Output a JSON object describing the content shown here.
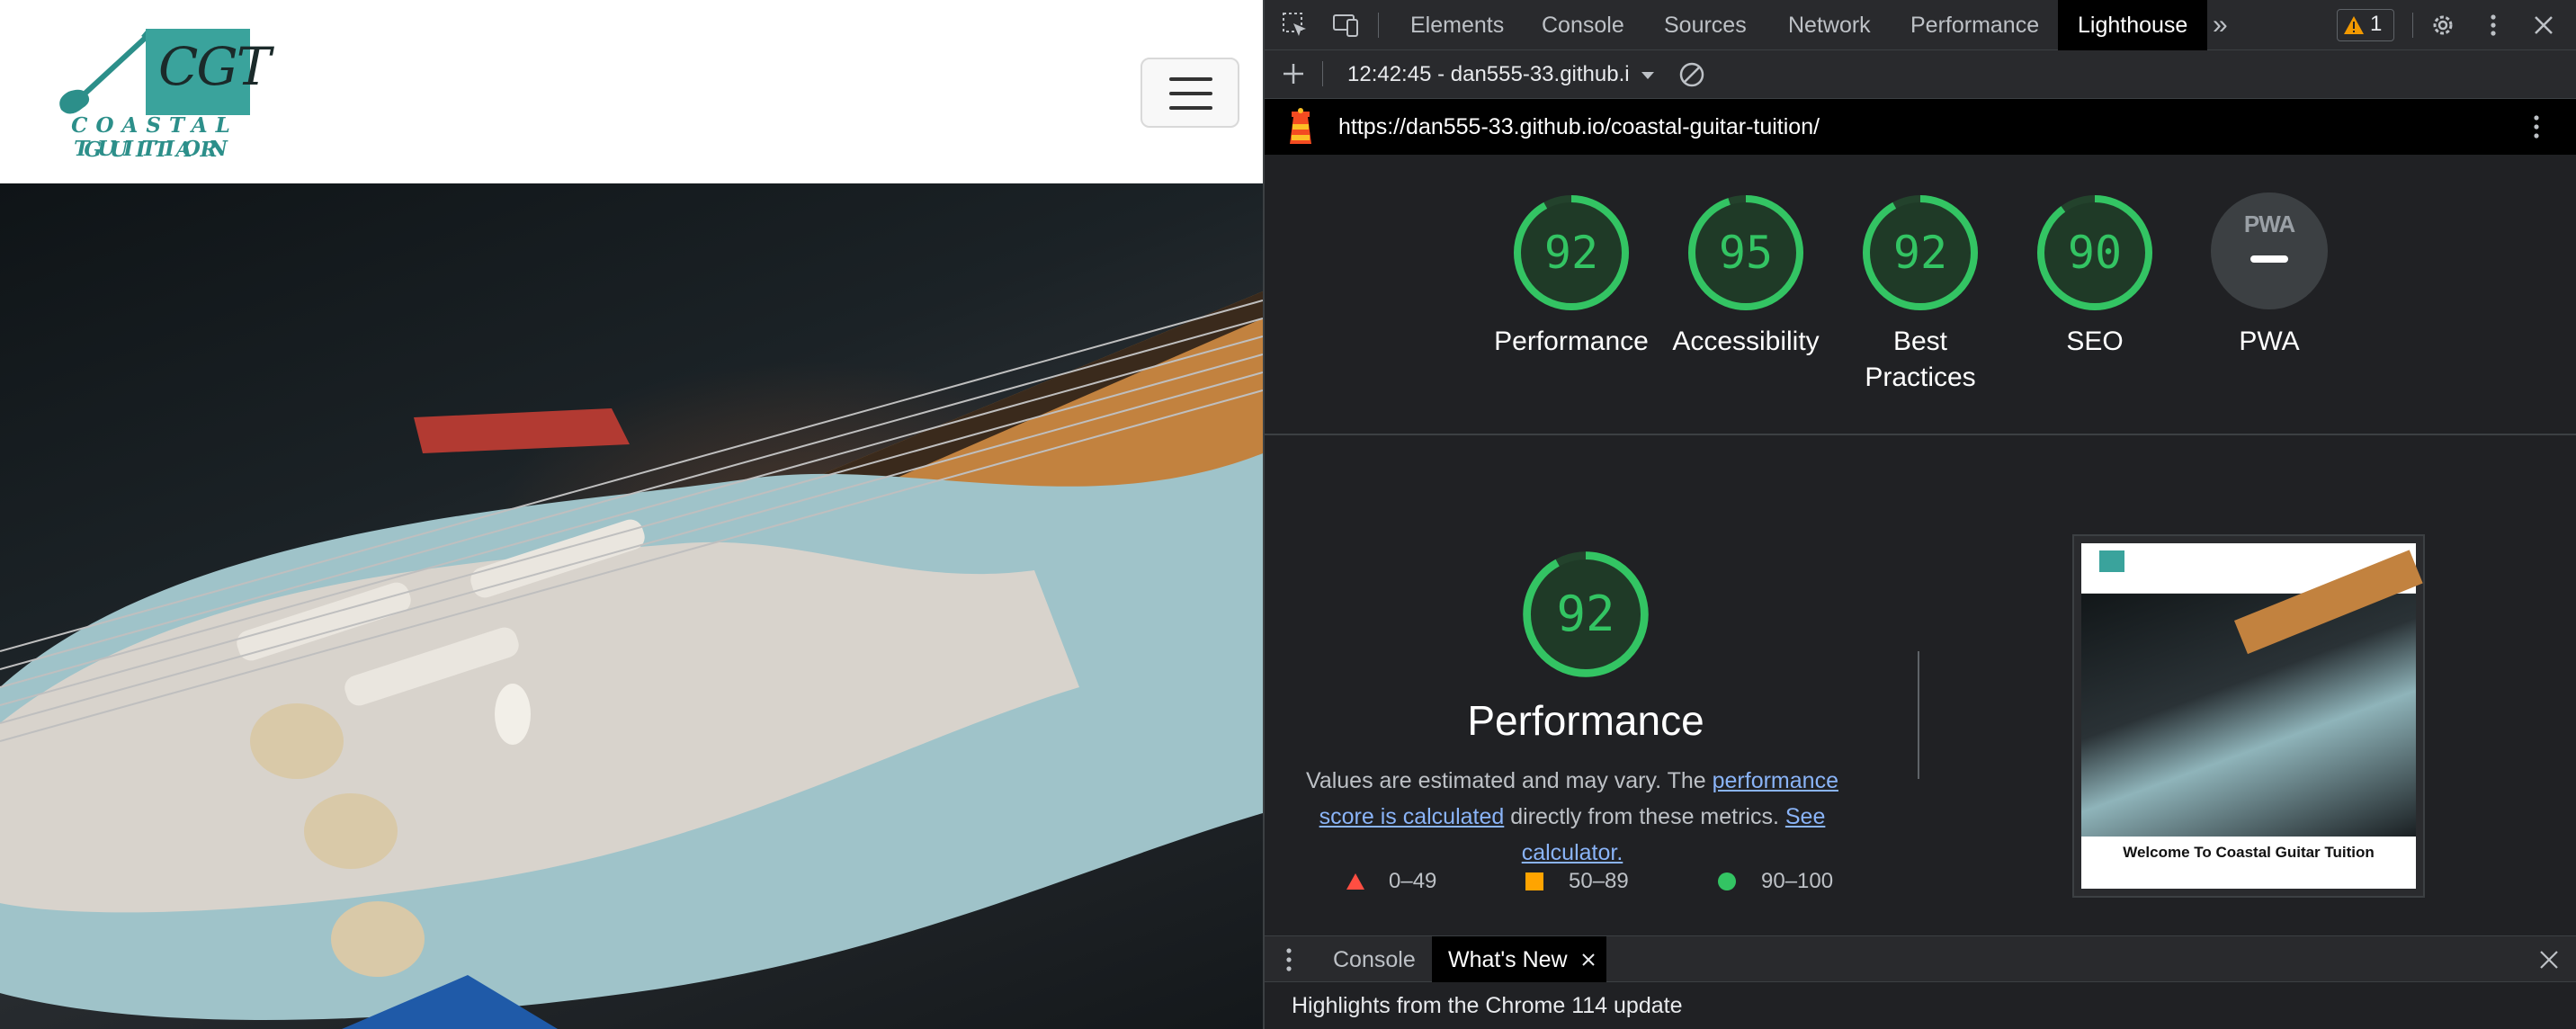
{
  "site": {
    "logo_monogram": "CGT",
    "logo_line1": "COASTAL GUITAR",
    "logo_line2": "TUITION"
  },
  "devtools": {
    "tabs": [
      "Elements",
      "Console",
      "Sources",
      "Network",
      "Performance",
      "Lighthouse"
    ],
    "active_tab": "Lighthouse",
    "more_tabs": "»",
    "warning_count": "1",
    "report_selector": "12:42:45 - dan555-33.github.i",
    "report_url": "https://dan555-33.github.io/coastal-guitar-tuition/",
    "categories": [
      {
        "score": "92",
        "label": "Performance",
        "value": 0.92
      },
      {
        "score": "95",
        "label": "Accessibility",
        "value": 0.95
      },
      {
        "score": "92",
        "label_line1": "Best",
        "label_line2": "Practices",
        "value": 0.92
      },
      {
        "score": "90",
        "label": "SEO",
        "value": 0.9
      }
    ],
    "pwa_label": "PWA",
    "pwa_badge": "PWA",
    "perf": {
      "score": "92",
      "value": 0.92,
      "title": "Performance",
      "desc_pre": "Values are estimated and may vary. The ",
      "desc_link1": "performance score is calculated",
      "desc_mid": " directly from these metrics. ",
      "desc_link2": "See calculator.",
      "legend_fail": "0–49",
      "legend_average": "50–89",
      "legend_pass": "90–100"
    },
    "thumbnail_caption": "Welcome To Coastal Guitar Tuition",
    "drawer_tabs": [
      "Console",
      "What's New"
    ],
    "drawer_text": "Highlights from the Chrome 114 update"
  },
  "colors": {
    "pass": "#33c463",
    "average": "#ffa400",
    "fail": "#ff4e42",
    "link": "#8ab4f8",
    "brand_teal": "#3aa39c"
  }
}
